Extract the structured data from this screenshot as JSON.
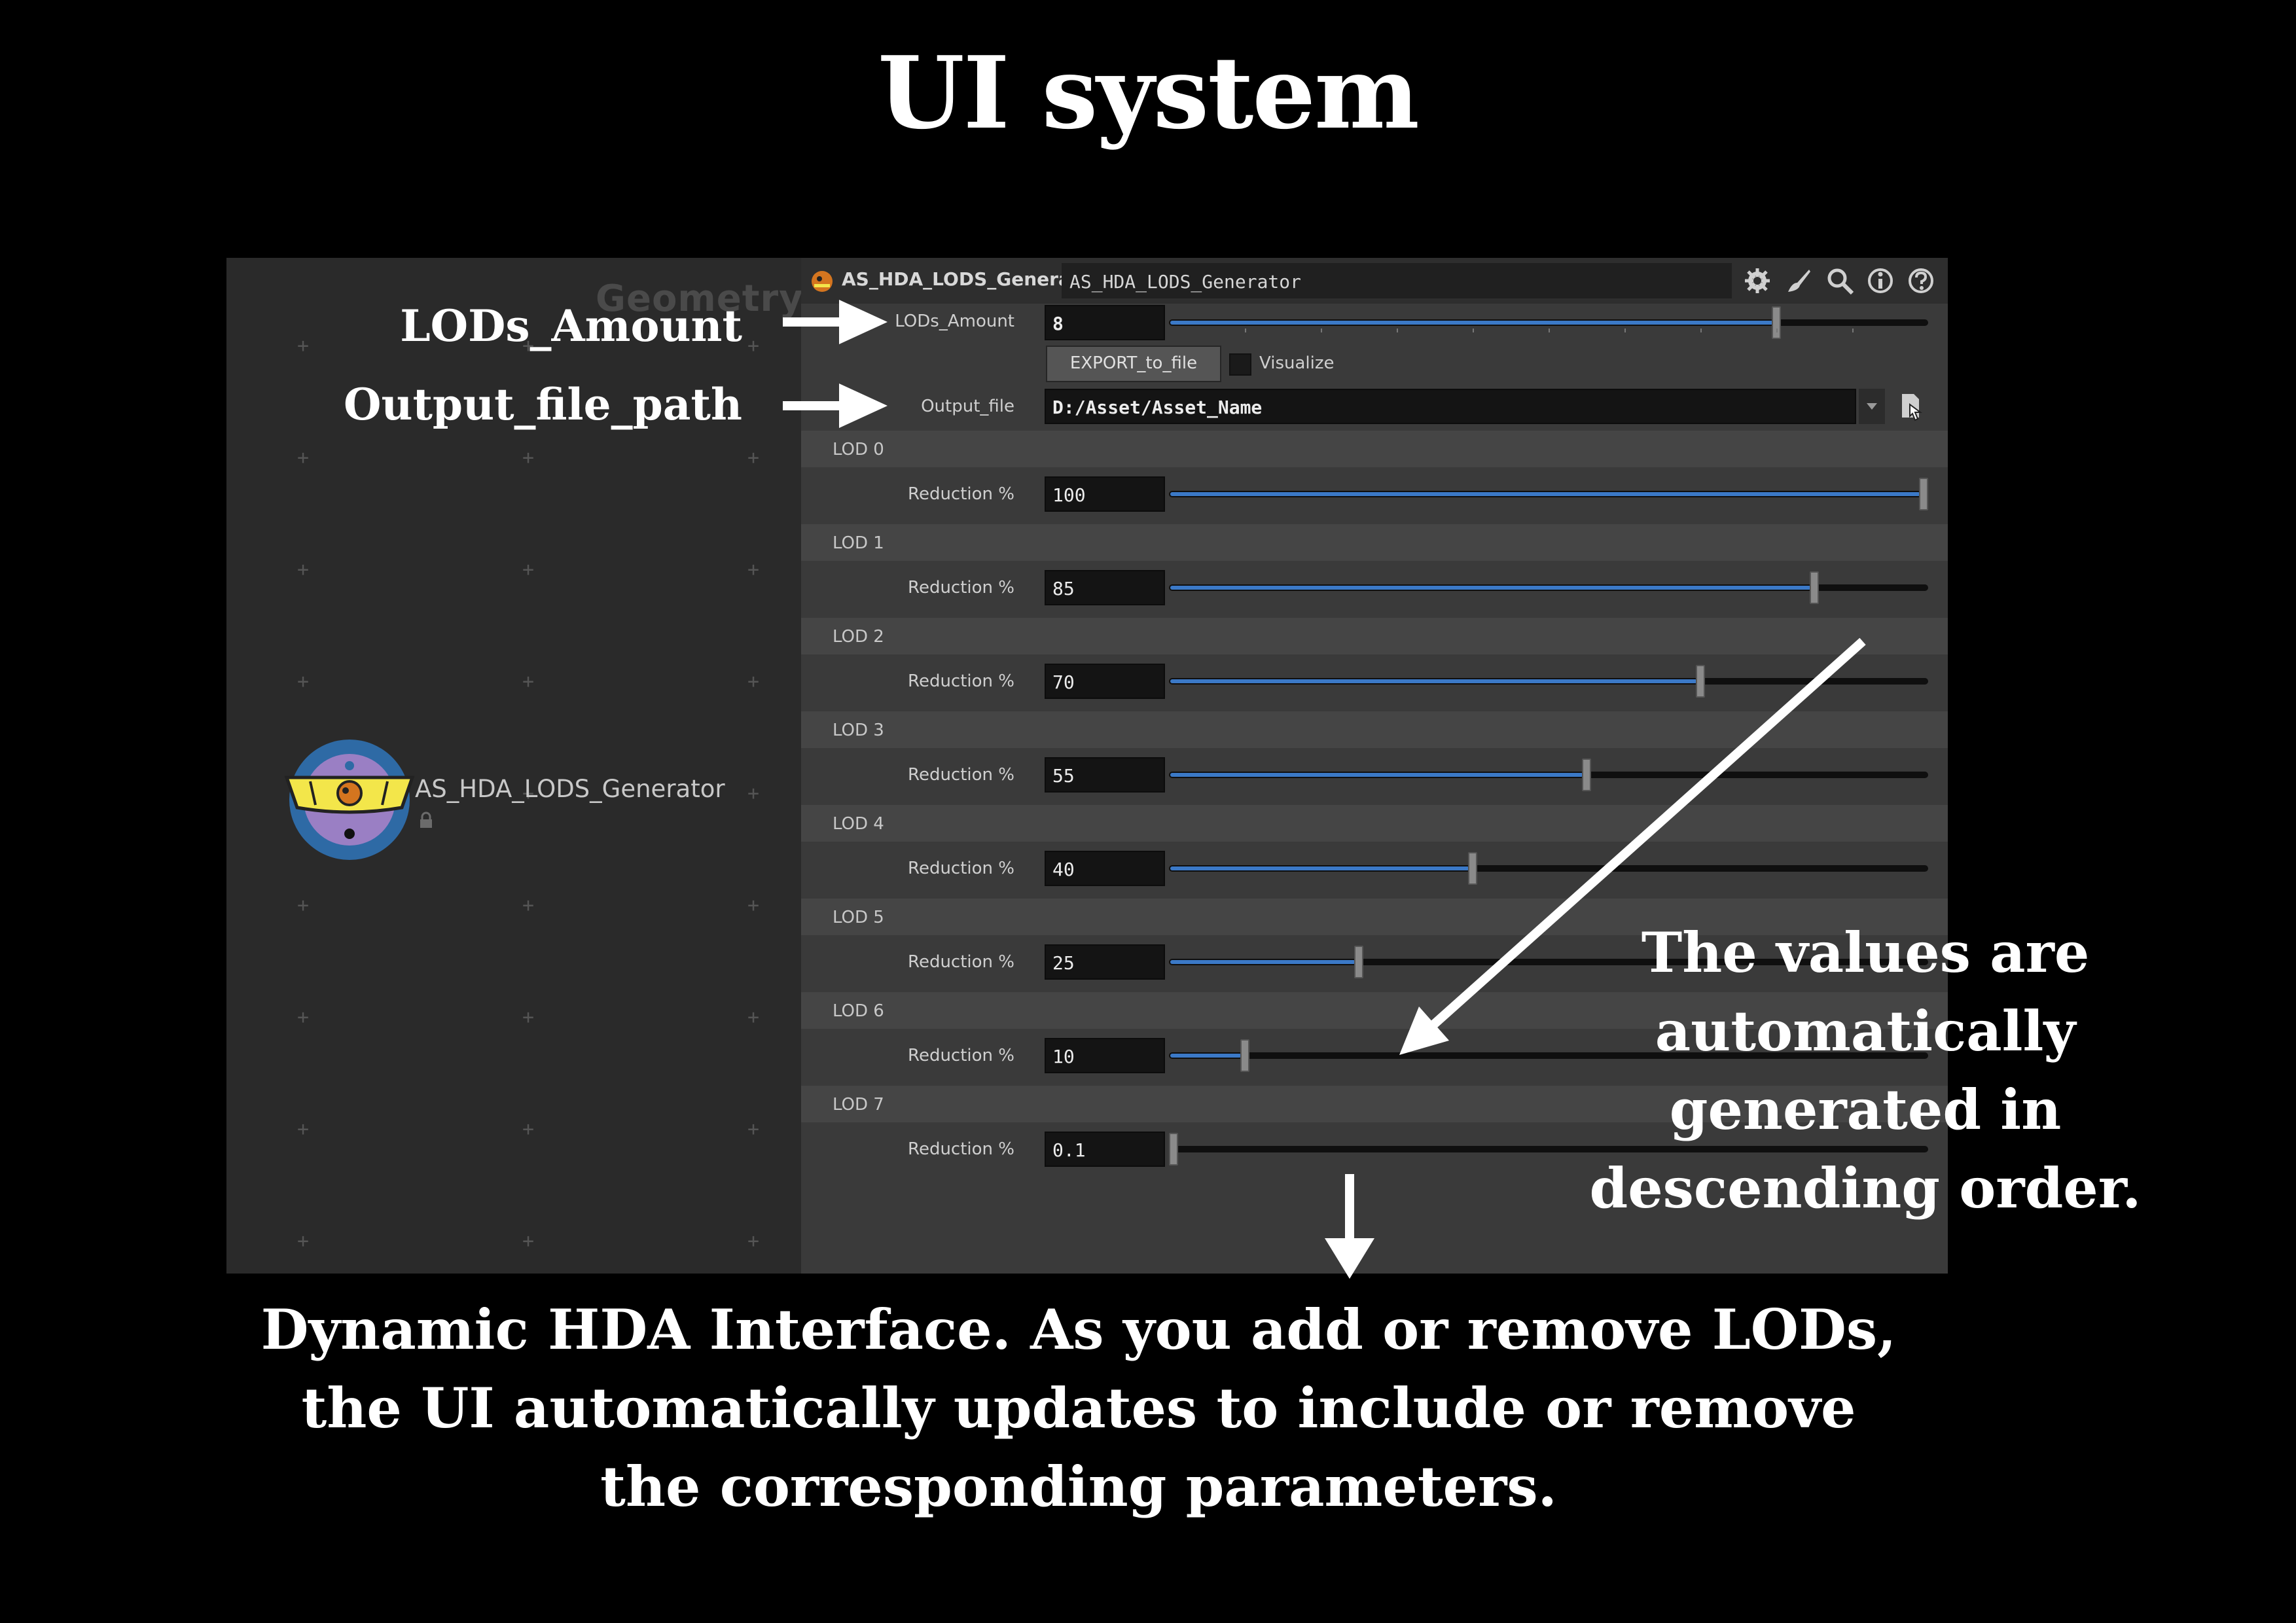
{
  "title": "UI system",
  "network": {
    "context_label": "Geometry",
    "node_label": "AS_HDA_LODS_Generator"
  },
  "panel": {
    "node_type": "AS_HDA_LODS_Generator",
    "node_name": "AS_HDA_LODS_Generator",
    "lods_amount": {
      "label": "LODs_Amount",
      "value": "8",
      "fraction": 0.8
    },
    "export_button": "EXPORT_to_file",
    "visualize": {
      "label": "Visualize",
      "checked": false
    },
    "output_file": {
      "label": "Output_file",
      "value": "D:/Asset/Asset_Name"
    },
    "lods": [
      {
        "header": "LOD 0",
        "label": "Reduction %",
        "value": "100",
        "fraction": 1.0
      },
      {
        "header": "LOD 1",
        "label": "Reduction %",
        "value": "85",
        "fraction": 0.85
      },
      {
        "header": "LOD 2",
        "label": "Reduction %",
        "value": "70",
        "fraction": 0.7
      },
      {
        "header": "LOD 3",
        "label": "Reduction %",
        "value": "55",
        "fraction": 0.55
      },
      {
        "header": "LOD 4",
        "label": "Reduction %",
        "value": "40",
        "fraction": 0.4
      },
      {
        "header": "LOD 5",
        "label": "Reduction %",
        "value": "25",
        "fraction": 0.25
      },
      {
        "header": "LOD 6",
        "label": "Reduction %",
        "value": "10",
        "fraction": 0.1
      },
      {
        "header": "LOD 7",
        "label": "Reduction %",
        "value": "0.1",
        "fraction": 0.001
      }
    ]
  },
  "annotations": {
    "lods_amount": "LODs_Amount",
    "output_file_path": "Output_file_path",
    "values_note": "The values are automatically generated in descending order.",
    "dynamic_note": "Dynamic HDA Interface. As you add or remove LODs, the UI automatically updates to include or remove the corresponding parameters."
  },
  "icons": [
    "gear-icon",
    "brush-icon",
    "search-icon",
    "info-icon",
    "help-icon",
    "lock-icon",
    "file-browse-icon",
    "dropdown-arrow-icon",
    "hda-node-icon"
  ],
  "colors": {
    "background": "#000000",
    "slider_fill": "#3b79c7",
    "panel": "#3a3a3a",
    "network": "#2a2a2a"
  }
}
